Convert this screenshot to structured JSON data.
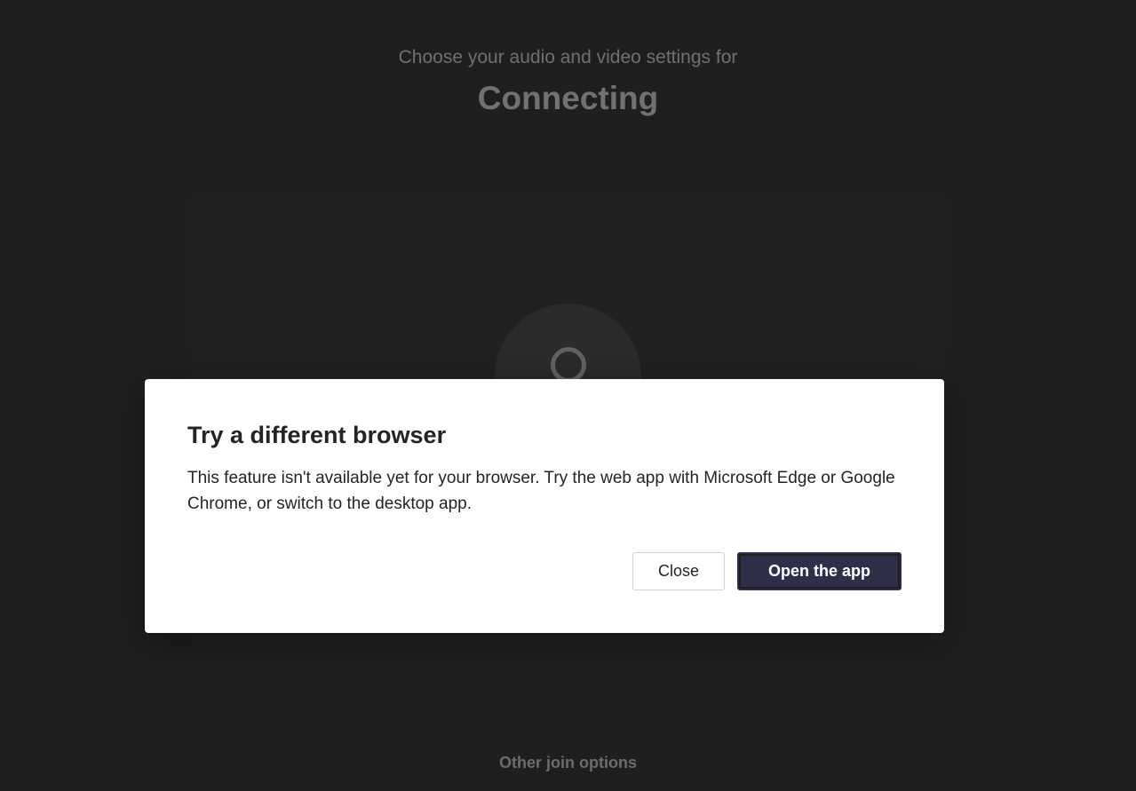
{
  "header": {
    "prompt": "Choose your audio and video settings for",
    "title": "Connecting"
  },
  "footer": {
    "other_options": "Other join options"
  },
  "dialog": {
    "title": "Try a different browser",
    "body": "This feature isn't available yet for your browser. Try the web app with Microsoft Edge or Google Chrome, or switch to the desktop app.",
    "close_label": "Close",
    "primary_label": "Open the app"
  }
}
